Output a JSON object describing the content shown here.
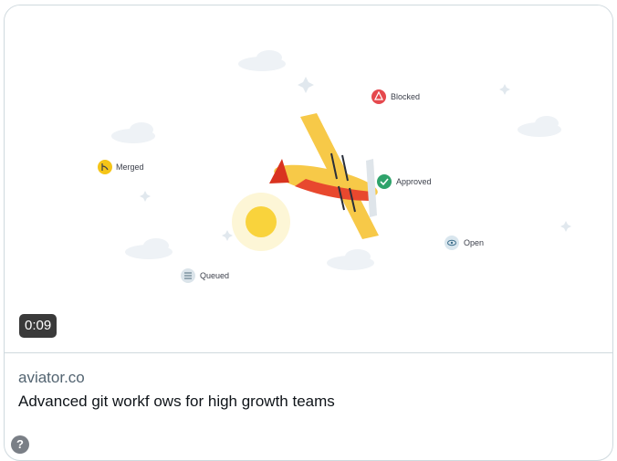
{
  "card": {
    "illustration": {
      "statuses": {
        "blocked": "Blocked",
        "merged": "Merged",
        "approved": "Approved",
        "open": "Open",
        "queued": "Queued"
      }
    },
    "duration": "0:09",
    "domain": "aviator.co",
    "title": "Advanced git workf ows for high growth teams",
    "help_glyph": "?"
  },
  "colors": {
    "plane_body": "#f7c948",
    "plane_stripe": "#e8482e",
    "sun": "#f9d33c",
    "blocked": "#e5484d",
    "approved": "#2fa36b",
    "merged": "#f5c518",
    "open": "#d9e6ee",
    "queued": "#dbe4ea",
    "cloud": "#eef2f6"
  }
}
